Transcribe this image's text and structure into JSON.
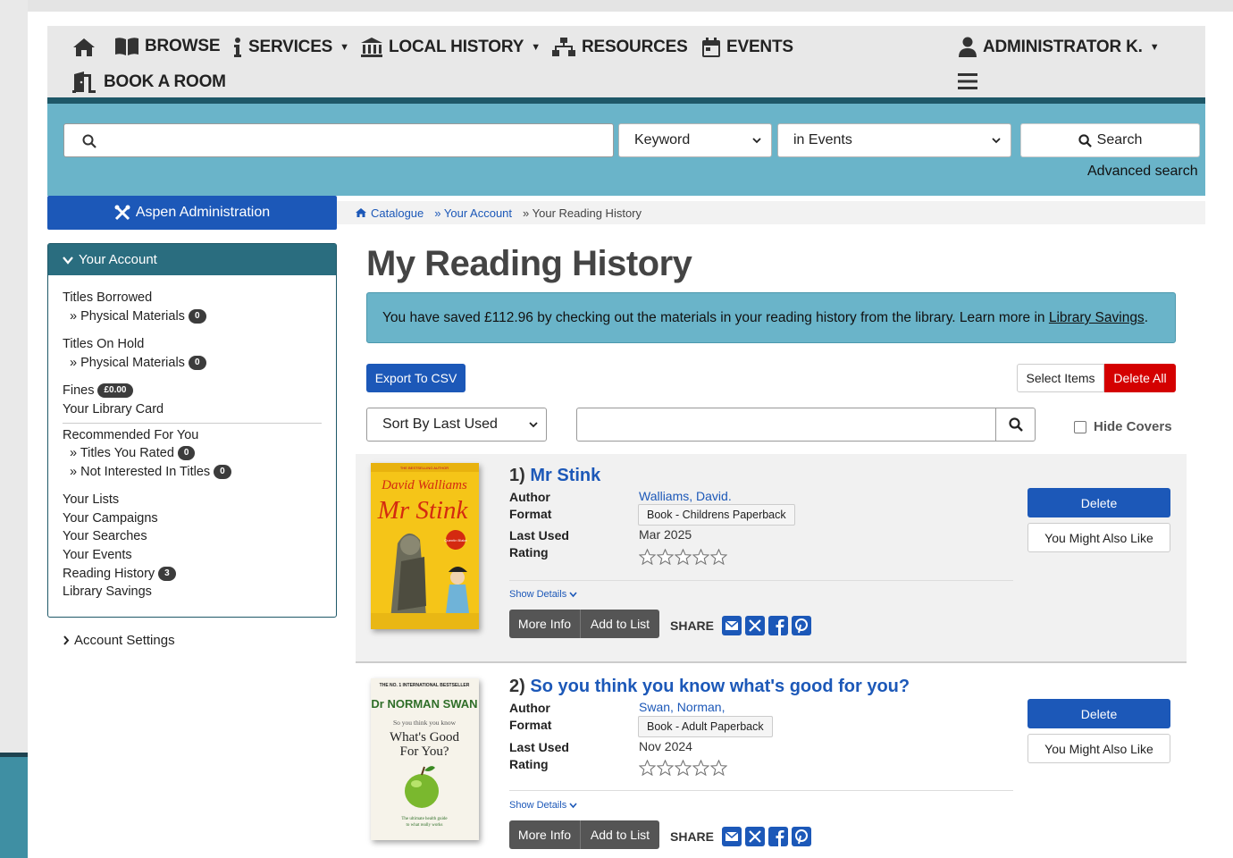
{
  "nav": {
    "browse": "BROWSE",
    "services": "SERVICES",
    "local_history": "LOCAL HISTORY",
    "resources": "RESOURCES",
    "events": "EVENTS",
    "book_room": "BOOK A ROOM",
    "user": "ADMINISTRATOR K."
  },
  "search": {
    "type_value": "Keyword",
    "scope_value": "in Events",
    "button_label": "Search",
    "advanced_label": "Advanced search"
  },
  "sidebar": {
    "admin_label": "Aspen Administration",
    "account_title": "Your Account",
    "items": {
      "titles_borrowed": "Titles Borrowed",
      "physical_materials_1": "» Physical Materials",
      "physical_materials_1_count": "0",
      "titles_on_hold": "Titles On Hold",
      "physical_materials_2": "» Physical Materials",
      "physical_materials_2_count": "0",
      "fines": "Fines",
      "fines_amount": "£0.00",
      "library_card": "Your Library Card",
      "recommended": "Recommended For You",
      "titles_rated": "» Titles You Rated",
      "titles_rated_count": "0",
      "not_interested": "» Not Interested In Titles",
      "not_interested_count": "0",
      "your_lists": "Your Lists",
      "your_campaigns": "Your Campaigns",
      "your_searches": "Your Searches",
      "your_events": "Your Events",
      "reading_history": "Reading History",
      "reading_history_count": "3",
      "library_savings": "Library Savings"
    },
    "account_settings": "Account Settings"
  },
  "breadcrumb": {
    "catalogue": "Catalogue",
    "account": "» Your Account",
    "current": "» Your Reading History"
  },
  "main": {
    "title": "My Reading History",
    "savings_text": "You have saved £112.96 by checking out the materials in your reading history from the library. Learn more in ",
    "savings_link": "Library Savings",
    "savings_end": ".",
    "export_label": "Export To CSV",
    "select_items_label": "Select Items",
    "delete_all_label": "Delete All",
    "sort_value": "Sort By Last Used",
    "hide_covers_label": "Hide Covers"
  },
  "labels": {
    "author": "Author",
    "format": "Format",
    "last_used": "Last Used",
    "rating": "Rating",
    "show_details": "Show Details",
    "more_info": "More Info",
    "add_to_list": "Add to List",
    "share": "SHARE",
    "delete": "Delete",
    "might_like": "You Might Also Like"
  },
  "results": [
    {
      "number": "1)",
      "title": "Mr Stink",
      "author": "Walliams, David.",
      "format": "Book - Childrens Paperback",
      "last_used": "Mar 2025",
      "rating": 0,
      "cover": {
        "top_text": "THE BESTSELLING AUTHOR",
        "author": "David Walliams",
        "title": "Mr Stink",
        "badge": "Quentin Blake"
      }
    },
    {
      "number": "2)",
      "title": "So you think you know what's good for you?",
      "author": "Swan, Norman,",
      "format": "Book - Adult Paperback",
      "last_used": "Nov 2024",
      "rating": 0,
      "cover": {
        "top_text": "THE NO. 1 INTERNATIONAL BESTSELLER",
        "author": "Dr NORMAN SWAN",
        "line1": "So you think you know",
        "line2": "What's Good",
        "line3": "For You?",
        "tagline1": "The ultimate health guide",
        "tagline2": "to what really works"
      }
    }
  ],
  "colors": {
    "primary_blue": "#1c58b8",
    "teal_band": "#6ab4c9",
    "dark_teal": "#1e5868",
    "danger_red": "#d40000"
  }
}
